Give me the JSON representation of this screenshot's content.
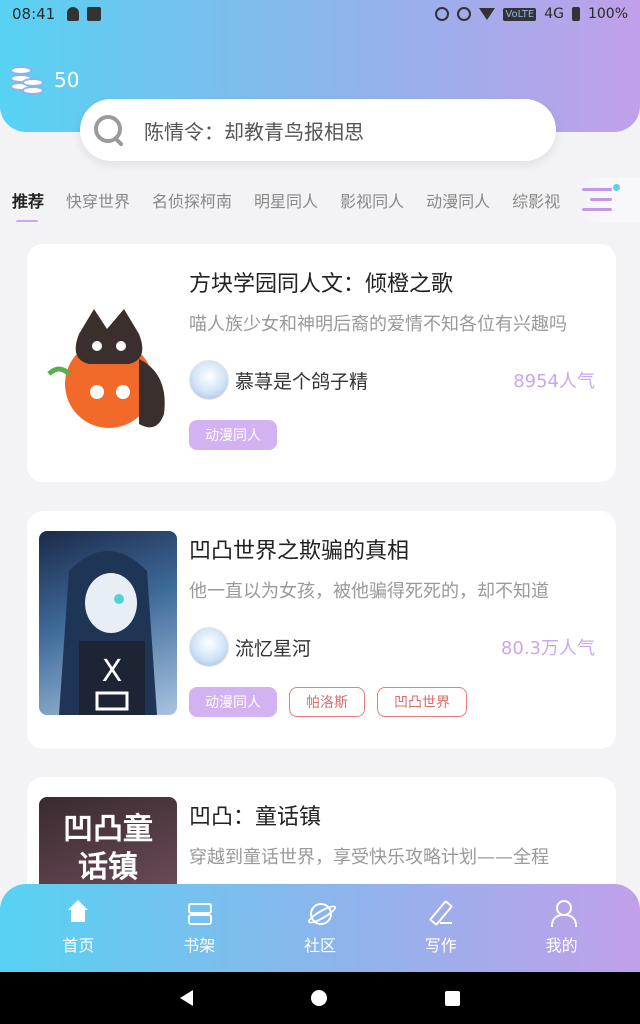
{
  "status_bar": {
    "time": "08:41",
    "network": "4G",
    "volte": "VoLTE",
    "battery": "100%"
  },
  "header": {
    "coins": "50"
  },
  "search": {
    "placeholder": "陈情令：却教青鸟报相思"
  },
  "tabs": [
    "推荐",
    "快穿世界",
    "名侦探柯南",
    "明星同人",
    "影视同人",
    "动漫同人",
    "综影视"
  ],
  "books": [
    {
      "title": "方块学园同人文：倾橙之歌",
      "desc": "喵人族少女和神明后裔的爱情不知各位有兴趣吗",
      "author": "慕荨是个鸽子精",
      "popularity": "8954人气",
      "tags": [
        {
          "label": "动漫同人",
          "style": "fill"
        }
      ]
    },
    {
      "title": "凹凸世界之欺骗的真相",
      "desc": "他一直以为女孩，被他骗得死死的，却不知道",
      "author": "流忆星河",
      "popularity": "80.3万人气",
      "tags": [
        {
          "label": "动漫同人",
          "style": "fill"
        },
        {
          "label": "帕洛斯",
          "style": "outline"
        },
        {
          "label": "凹凸世界",
          "style": "outline"
        }
      ]
    },
    {
      "title": "凹凸：童话镇",
      "desc": "穿越到童话世界，享受快乐攻略计划——全程",
      "cover_text": "凹凸童话镇"
    }
  ],
  "bottom_nav": [
    {
      "label": "首页",
      "icon": "home-icon"
    },
    {
      "label": "书架",
      "icon": "bookshelf-icon"
    },
    {
      "label": "社区",
      "icon": "community-icon"
    },
    {
      "label": "写作",
      "icon": "write-icon"
    },
    {
      "label": "我的",
      "icon": "profile-icon"
    }
  ],
  "colors": {
    "accent": "#c9a7ef",
    "gradient_start": "#57d2f2",
    "gradient_end": "#c1a0ea",
    "tag_outline": "#e87c7c"
  }
}
